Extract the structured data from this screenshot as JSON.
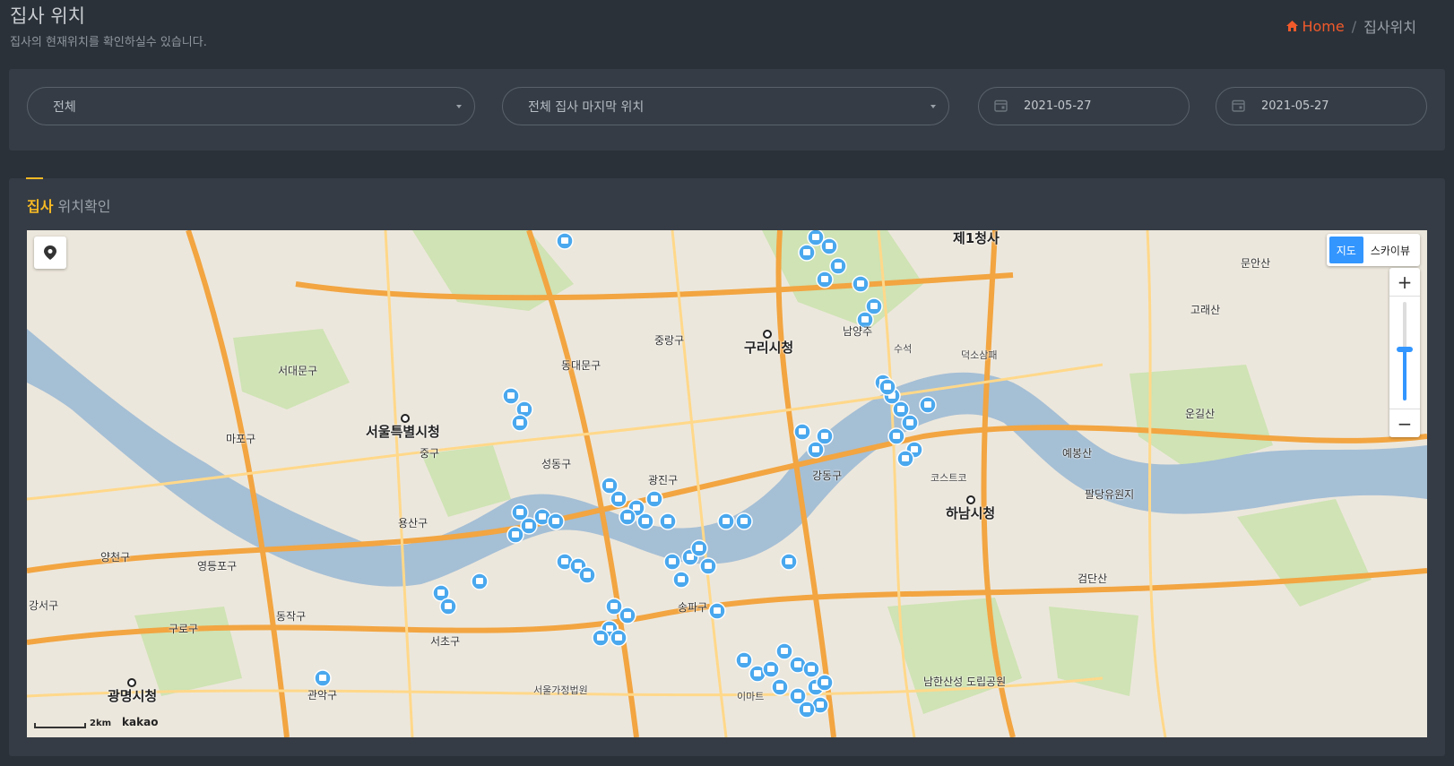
{
  "header": {
    "title": "집사 위치",
    "subtitle": "집사의 현재위치를 확인하실수 있습니다.",
    "breadcrumb": {
      "home": "Home",
      "separator": "/",
      "current": "집사위치"
    }
  },
  "filters": {
    "group_select": "전체",
    "mode_select": "전체 집사 마지막 위치",
    "date_from": "2021-05-27",
    "date_to": "2021-05-27"
  },
  "map_card": {
    "title_highlight": "집사",
    "title_rest": "위치확인"
  },
  "map": {
    "type_buttons": [
      "지도",
      "스카이뷰"
    ],
    "active_type": "지도",
    "zoom_in": "+",
    "zoom_out": "−",
    "zoom_level_fraction": 0.55,
    "scale": "2km",
    "attribution": "kakao",
    "labels": [
      "제1청사",
      "구리시청",
      "서울특별시청",
      "하남시청",
      "광명시청",
      "마포구",
      "서대문구",
      "동대문구",
      "중랑구",
      "성동구",
      "광진구",
      "용산구",
      "중구",
      "강동구",
      "송파구",
      "동작구",
      "관악구",
      "구로구",
      "양천구",
      "영등포구",
      "강서구",
      "서초구",
      "남양주",
      "이마트",
      "코스트코",
      "서울가정법원",
      "남한산성 도립공원",
      "팔당유원지",
      "검단산",
      "예봉산",
      "운길산",
      "고래산",
      "문안산",
      "수석",
      "덕소삼패"
    ]
  },
  "colors": {
    "background": "#2b3139",
    "card": "#353c45",
    "accent": "#f6b924",
    "breadcrumb_home": "#f15a2b",
    "marker": "#4aa8ee",
    "map_button_active": "#3396ff"
  }
}
